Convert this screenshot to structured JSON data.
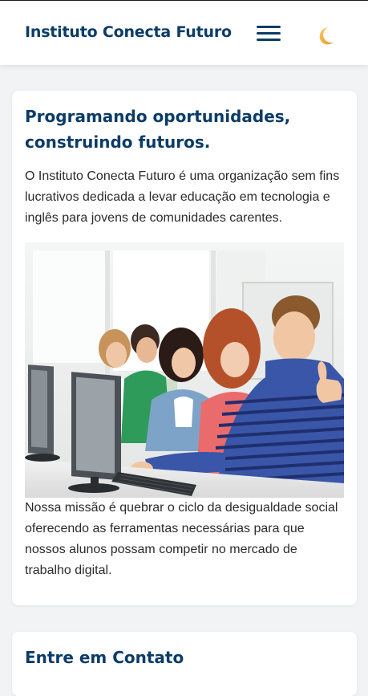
{
  "header": {
    "brand": "Instituto Conecta Futuro",
    "menu_icon": "hamburger-menu-icon",
    "theme_icon": "crescent-moon-icon"
  },
  "about": {
    "title": "Programando oportunidades, construindo futuros.",
    "intro": "O Instituto Conecta Futuro é uma organização sem fins lucrativos dedicada a levar educação em tecnologia e inglês para jovens de comunidades carentes.",
    "mission": "Nossa missão é quebrar o ciclo da desigualdade social oferecendo as ferramentas necessárias para que nossos alunos possam competir no mercado de trabalho digital."
  },
  "contact": {
    "title": "Entre em Contato"
  },
  "colors": {
    "brand": "#0b3c68",
    "moon": "#f2b13c",
    "background": "#f2f3f4",
    "card": "#ffffff",
    "text": "#2b2b2b"
  }
}
